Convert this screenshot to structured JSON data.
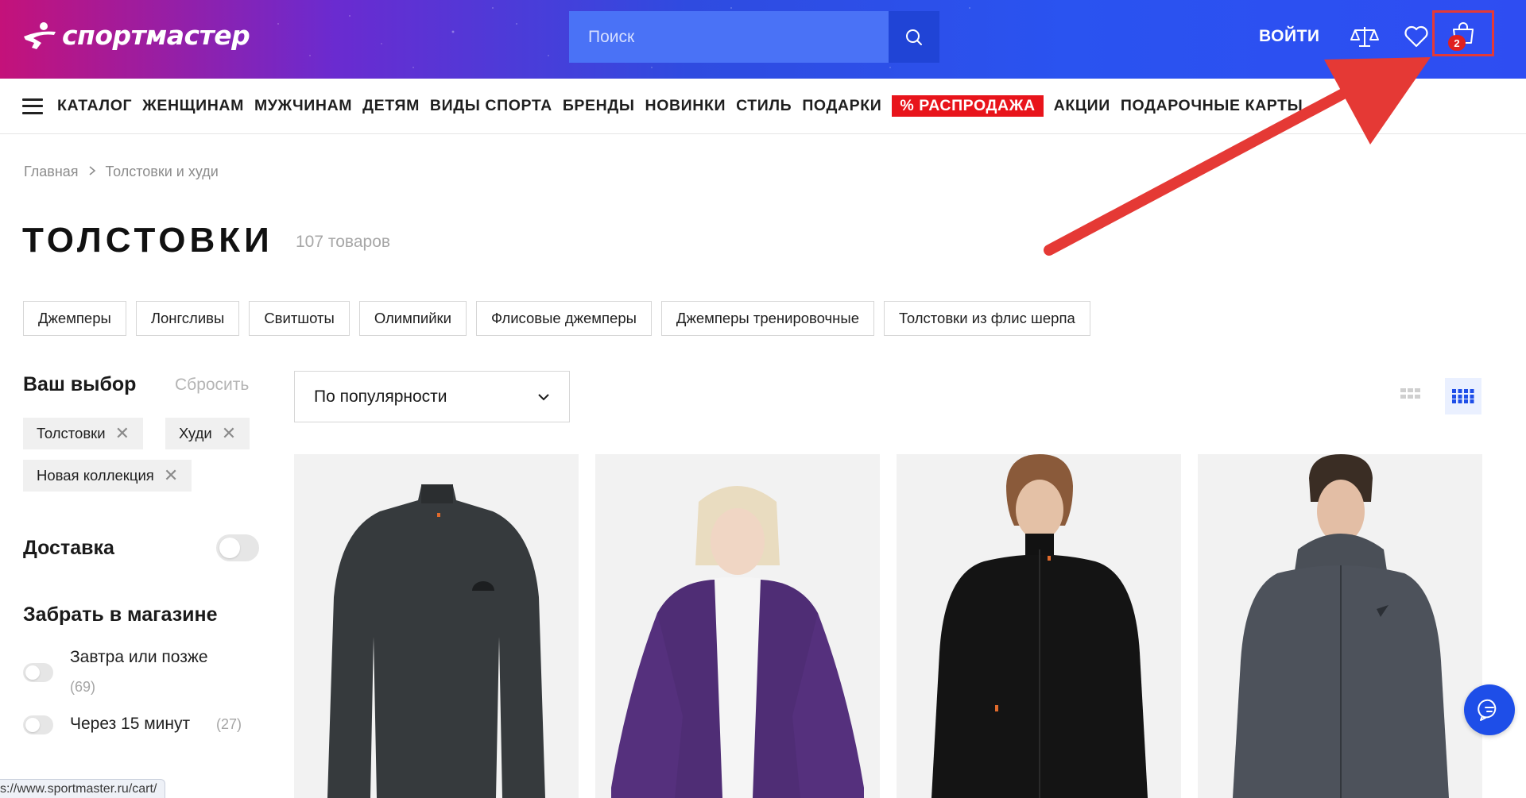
{
  "header": {
    "logo_text": "спортмастер",
    "search_placeholder": "Поиск",
    "login_label": "ВОЙТИ",
    "cart_count": "2",
    "icons": [
      "compare-icon",
      "heart-icon",
      "cart-icon",
      "search-icon"
    ]
  },
  "nav": {
    "items": [
      "КАТАЛОГ",
      "ЖЕНЩИНАМ",
      "МУЖЧИНАМ",
      "ДЕТЯМ",
      "ВИДЫ СПОРТА",
      "БРЕНДЫ",
      "НОВИНКИ",
      "СТИЛЬ",
      "ПОДАРКИ"
    ],
    "sale_label": "% РАСПРОДАЖА",
    "items_after": [
      "АКЦИИ",
      "ПОДАРОЧНЫЕ КАРТЫ"
    ]
  },
  "breadcrumb": {
    "home": "Главная",
    "current": "Толстовки и худи"
  },
  "page": {
    "title": "ТОЛСТОВКИ",
    "count": "107 товаров"
  },
  "categories": [
    "Джемперы",
    "Лонгсливы",
    "Свитшоты",
    "Олимпийки",
    "Флисовые джемперы",
    "Джемперы тренировочные",
    "Толстовки из флис шерпа"
  ],
  "filters": {
    "title": "Ваш выбор",
    "reset": "Сбросить",
    "tags": [
      "Толстовки",
      "Худи",
      "Новая коллекция"
    ],
    "delivery_label": "Доставка",
    "pickup_label": "Забрать в магазине",
    "pickup_options": [
      {
        "label": "Завтра или позже",
        "count": "(69)"
      },
      {
        "label": "Через 15 минут",
        "count": "(27)"
      }
    ]
  },
  "sort": {
    "selected": "По популярности"
  },
  "status_bar": {
    "url": "s://www.sportmaster.ru/cart/"
  },
  "colors": {
    "brand_blue": "#2e4df2",
    "sale_red": "#e8141b",
    "annotation_red": "#e53935"
  }
}
